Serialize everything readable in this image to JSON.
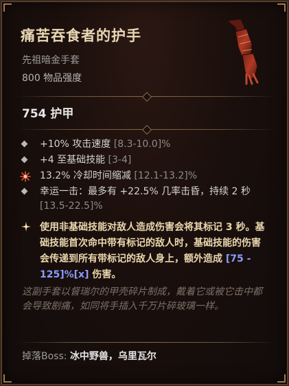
{
  "item": {
    "name": "痛苦吞食者的护手",
    "type": "先祖暗金手套",
    "power": "800 物品强度"
  },
  "armor": "754 护甲",
  "affixes": [
    {
      "text": "+10% 攻击速度 ",
      "range": "[8.3-10.0]%"
    },
    {
      "text": "+4 至基础技能 ",
      "range": "[3-4]"
    },
    {
      "text": "13.2% 冷却时间缩减 ",
      "range": "[12.1-13.2]%"
    },
    {
      "text": "幸运一击：最多有 +22.5% 几率击昏，持续 2 秒 ",
      "range": "[13.5-22.5]%"
    }
  ],
  "aspect": {
    "text_before": "使用非基础技能对敌人造成伤害会将其标记 3 秒。基础技能首次命中带有标记的敌人时，基础技能的伤害会传递到所有带标记的敌人身上，额外造成 ",
    "value": "[75 - 125]%[x]",
    "text_after": " 伤害。"
  },
  "flavor": "这副手套以督瑞尔的甲壳碎片制成，戴着它或被它击中都会导致剧痛，如同将手插入千万片碎玻璃一样。",
  "boss": {
    "label": "掉落Boss: ",
    "names": "冰中野兽，乌里瓦尔"
  },
  "colors": {
    "unique_name": "#e9d7b4",
    "aspect_text": "#ead7ae",
    "value_blue": "#8b9cff",
    "flavor": "#7e6f67",
    "background": "#1a0f0c"
  },
  "icons": [
    "unique-gloves-icon",
    "affix-bullet-icon",
    "tempered-affix-icon",
    "unique-aspect-star-icon",
    "divider-gem-icon"
  ]
}
